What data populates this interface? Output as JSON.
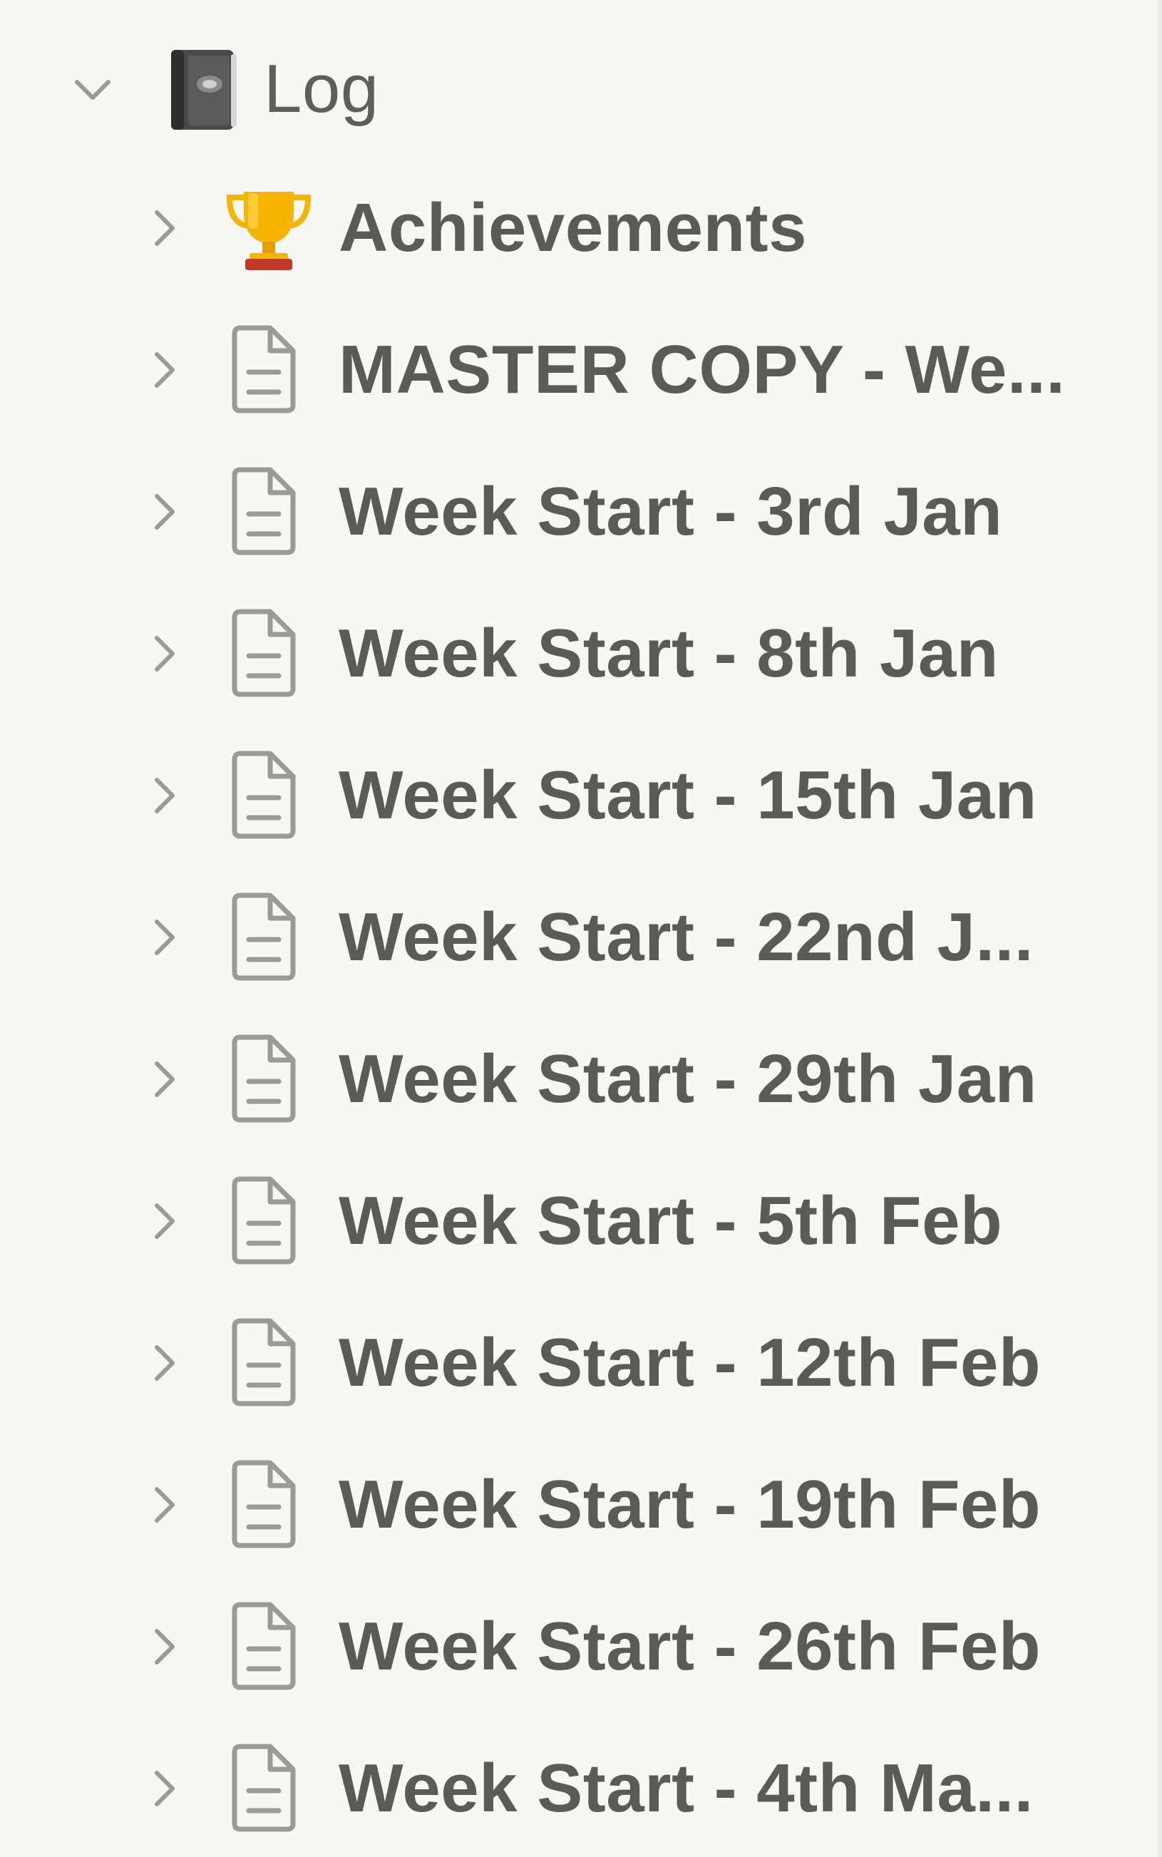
{
  "sidebar": {
    "root": {
      "label": "Log",
      "icon": "notebook-icon",
      "expanded": true
    },
    "items": [
      {
        "label": "Achievements",
        "icon": "trophy-icon"
      },
      {
        "label": "MASTER COPY - We...",
        "icon": "page-icon"
      },
      {
        "label": "Week Start - 3rd Jan",
        "icon": "page-icon"
      },
      {
        "label": "Week Start - 8th Jan",
        "icon": "page-icon"
      },
      {
        "label": "Week Start - 15th Jan",
        "icon": "page-icon"
      },
      {
        "label": "Week Start - 22nd J...",
        "icon": "page-icon"
      },
      {
        "label": "Week Start - 29th Jan",
        "icon": "page-icon"
      },
      {
        "label": "Week Start - 5th Feb",
        "icon": "page-icon"
      },
      {
        "label": "Week Start - 12th Feb",
        "icon": "page-icon"
      },
      {
        "label": "Week Start - 19th Feb",
        "icon": "page-icon"
      },
      {
        "label": "Week Start - 26th Feb",
        "icon": "page-icon"
      },
      {
        "label": "Week Start - 4th Ma...",
        "icon": "page-icon"
      }
    ]
  },
  "colors": {
    "background": "#f7f7f5",
    "text": "#5f5e5b",
    "icon_stroke": "#9b9a97",
    "divider": "#ebeae6"
  }
}
